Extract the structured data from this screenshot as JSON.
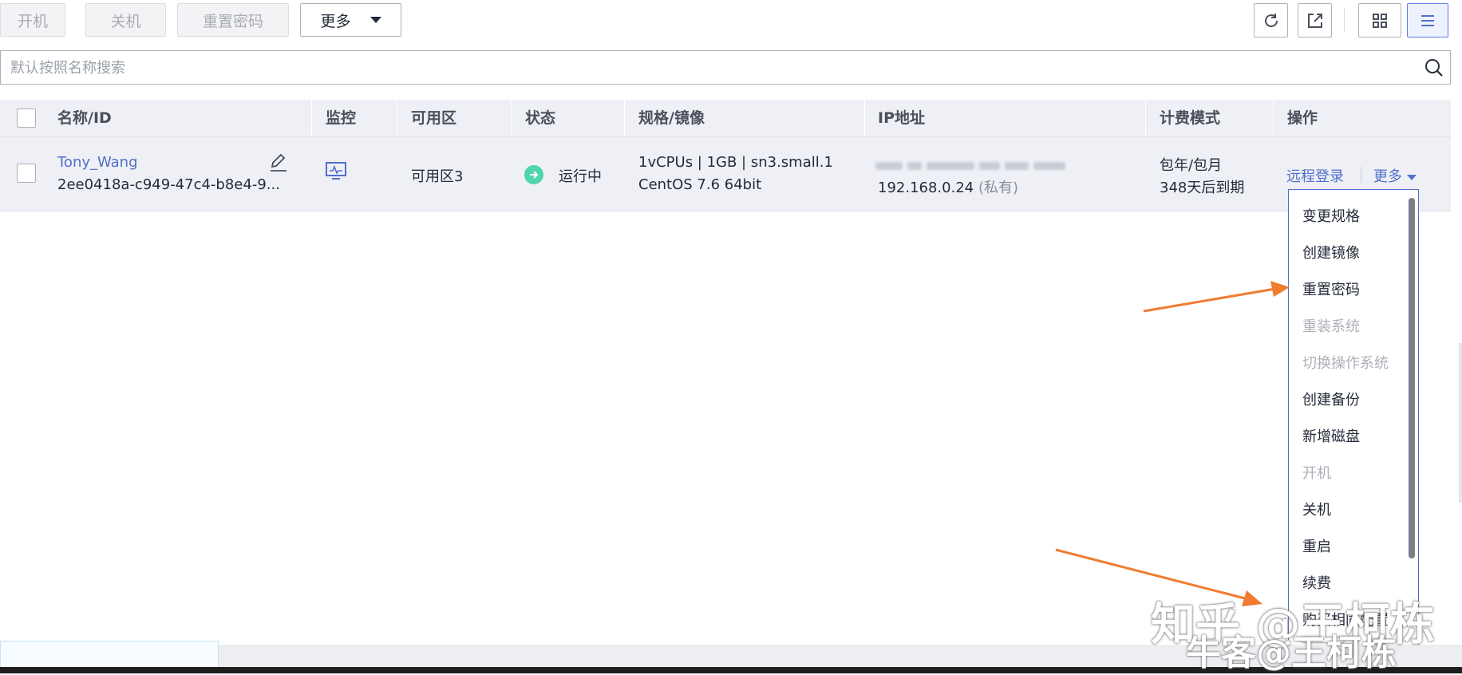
{
  "toolbar": {
    "power_on": "开机",
    "power_off": "关机",
    "reset_password": "重置密码",
    "more": "更多"
  },
  "search": {
    "placeholder": "默认按照名称搜索"
  },
  "table": {
    "headers": {
      "name_id": "名称/ID",
      "monitor": "监控",
      "az": "可用区",
      "status": "状态",
      "spec": "规格/镜像",
      "ip": "IP地址",
      "billing": "计费模式",
      "actions": "操作"
    },
    "rows": [
      {
        "name": "Tony_Wang",
        "id": "2ee0418a-c949-47c4-b8e4-9...",
        "az": "可用区3",
        "status": "运行中",
        "spec": "1vCPUs | 1GB | sn3.small.1",
        "image": "CentOS 7.6 64bit",
        "private_ip": "192.168.0.24",
        "private_label": "(私有)",
        "billing_mode": "包年/包月",
        "expiry": "348天后到期",
        "remote_login": "远程登录",
        "more": "更多"
      }
    ]
  },
  "dropdown": {
    "items": [
      {
        "label": "变更规格",
        "disabled": false
      },
      {
        "label": "创建镜像",
        "disabled": false
      },
      {
        "label": "重置密码",
        "disabled": false
      },
      {
        "label": "重装系统",
        "disabled": true
      },
      {
        "label": "切换操作系统",
        "disabled": true
      },
      {
        "label": "创建备份",
        "disabled": false
      },
      {
        "label": "新增磁盘",
        "disabled": false
      },
      {
        "label": "开机",
        "disabled": true
      },
      {
        "label": "关机",
        "disabled": false
      },
      {
        "label": "重启",
        "disabled": false
      },
      {
        "label": "续费",
        "disabled": false
      },
      {
        "label": "购买相同配置",
        "disabled": false
      }
    ]
  },
  "watermark": {
    "line1": "知乎 @王柯栋",
    "line2": "牛客@王柯栋"
  },
  "colors": {
    "accent": "#526ecc",
    "status_running": "#50d4ab",
    "annotation_arrow": "#f07c2f"
  }
}
